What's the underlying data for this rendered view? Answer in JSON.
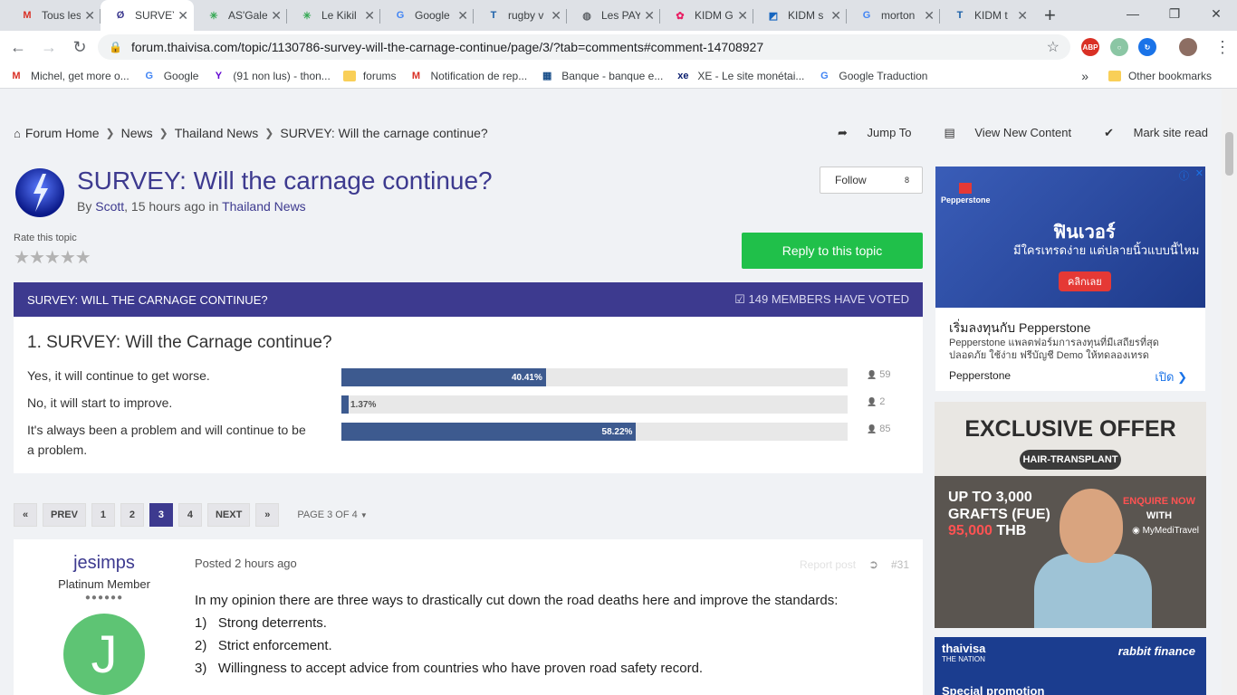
{
  "browser": {
    "tabs": [
      {
        "title": "Tous les",
        "icon": "gmail-icon",
        "color": "#d93025"
      },
      {
        "title": "SURVEY",
        "icon": "thaivisa-icon",
        "color": "#3d3a8f",
        "active": true
      },
      {
        "title": "AS'Gale",
        "icon": "star-icon",
        "color": "#34a853"
      },
      {
        "title": "Le Kikil",
        "icon": "star-icon",
        "color": "#34a853"
      },
      {
        "title": "Google",
        "icon": "google-translate-icon",
        "color": "#4285f4"
      },
      {
        "title": "rugby v",
        "icon": "t2-icon",
        "color": "#1a5fa8"
      },
      {
        "title": "Les PAY",
        "icon": "globe-icon",
        "color": "#5f6368"
      },
      {
        "title": "KIDM G",
        "icon": "flower-icon",
        "color": "#e91e63"
      },
      {
        "title": "KIDM s",
        "icon": "kidm-icon",
        "color": "#1565c0"
      },
      {
        "title": "morton",
        "icon": "google-icon",
        "color": "#4285f4"
      },
      {
        "title": "KIDM t",
        "icon": "t2-icon",
        "color": "#1a5fa8"
      }
    ],
    "url": "forum.thaivisa.com/topic/1130786-survey-will-the-carnage-continue/page/3/?tab=comments#comment-14708927",
    "bookmarks": [
      {
        "label": "Michel, get more o...",
        "icon": "gmail-icon"
      },
      {
        "label": "Google",
        "icon": "google-icon"
      },
      {
        "label": "(91 non lus) - thon...",
        "icon": "yahoo-icon"
      },
      {
        "label": "forums",
        "icon": "folder-icon"
      },
      {
        "label": "Notification de rep...",
        "icon": "gmail-icon"
      },
      {
        "label": "Banque - banque e...",
        "icon": "bank-icon"
      },
      {
        "label": "XE - Le site monétai...",
        "icon": "xe-icon"
      },
      {
        "label": "Google Traduction",
        "icon": "google-translate-icon"
      }
    ],
    "more_bookmarks": "»",
    "other_bookmarks": "Other bookmarks"
  },
  "breadcrumb": [
    "Forum Home",
    "News",
    "Thailand News",
    "SURVEY: Will the carnage continue?"
  ],
  "top_links": {
    "jump": "Jump To",
    "view_new": "View New Content",
    "mark_read": "Mark site read"
  },
  "topic": {
    "title": "SURVEY: Will the carnage continue?",
    "by_prefix": "By",
    "author": "Scott",
    "time": ", 15 hours ago in",
    "forum": "Thailand News",
    "follow_label": "Follow",
    "follow_count": "8",
    "rate_label": "Rate this topic",
    "reply_label": "Reply to this topic"
  },
  "poll": {
    "header": "SURVEY: Will the carnage continue?",
    "votes": "149 members have voted",
    "question": "1. SURVEY: Will the Carnage continue?",
    "options": [
      {
        "label": "Yes, it will continue to get worse.",
        "pct_text": "40.41%",
        "pct": 40.41,
        "count": "59"
      },
      {
        "label": "No, it will start to improve.",
        "pct_text": "1.37%",
        "pct": 1.37,
        "count": "2"
      },
      {
        "label": "It's always been a problem and will continue to be a problem.",
        "pct_text": "58.22%",
        "pct": 58.22,
        "count": "85"
      }
    ]
  },
  "pagination": {
    "first": "«",
    "prev": "Prev",
    "pages": [
      "1",
      "2",
      "3",
      "4"
    ],
    "current": "3",
    "next": "Next",
    "last": "»",
    "page_of": "Page 3 of 4"
  },
  "post": {
    "author": "jesimps",
    "rank": "Platinum Member",
    "rank_pips": "●●●●●●",
    "avatar_letter": "J",
    "posted_label": "Posted",
    "posted_time": "2 hours ago",
    "report": "Report post",
    "number": "#31",
    "lines": [
      "In my opinion there are three ways to drastically cut down the road deaths here and improve the standards:",
      "1)   Strong deterrents.",
      "2)   Strict enforcement.",
      "3)   Willingness to accept advice from countries who have proven road safety record."
    ]
  },
  "ads": {
    "pepperstone": {
      "brand": "Pepperstone",
      "thai_big": "ฟินเวอร์",
      "thai_sub": "มีใครเทรดง่าย แต่ปลายนิ้วแบบนี้ไหม",
      "cta": "คลิกเลย",
      "headline": "เริ่มลงทุนกับ Pepperstone",
      "desc": "Pepperstone แพลตฟอร์มการลงทุนที่มีเสถียรที่สุด ปลอดภัย ใช้ง่าย ฟรีบัญชี Demo ให้ทดลองเทรด",
      "source": "Pepperstone",
      "open": "เปิด"
    },
    "hair": {
      "headline": "EXCLUSIVE OFFER",
      "pill": "HAIR-TRANSPLANT",
      "line1": "UP TO 3,000",
      "line2": "GRAFTS (FUE)",
      "price": "95,000",
      "currency": "THB",
      "enquire": "ENQUIRE NOW",
      "with": "WITH",
      "partner": "MyMediTravel"
    },
    "rabbit": {
      "left": "thaivisa",
      "left_sub": "THE NATION",
      "right": "rabbit finance",
      "bottom": "Special promotion"
    }
  }
}
